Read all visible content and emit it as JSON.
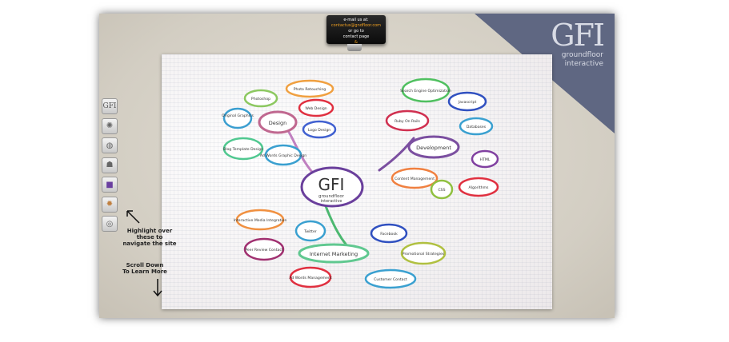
{
  "contact": {
    "line1": "e-mail us at:",
    "email": "contactus@gndfloor.com",
    "line3": "or go to",
    "line4": "contact page",
    "amp": "&"
  },
  "brand": {
    "logo": "GFI",
    "line1": "groundfloor",
    "line2": "interactive"
  },
  "nav": {
    "items": [
      {
        "label": "GFI",
        "icon": "gfi-logo-icon"
      },
      {
        "icon": "pinwheel-icon"
      },
      {
        "icon": "disc-icon"
      },
      {
        "icon": "people-icon"
      },
      {
        "icon": "book-icon"
      },
      {
        "icon": "globe-icon"
      },
      {
        "icon": "compass-icon"
      }
    ]
  },
  "hints": {
    "highlight": [
      "Highlight over",
      "these to",
      "navigate the site"
    ],
    "scroll": [
      "Scroll Down",
      "To Learn More"
    ]
  },
  "mindmap": {
    "center": {
      "logo": "GFI",
      "line1": "groundfloor",
      "line2": "interactive"
    },
    "design": {
      "hub": "Design",
      "bubbles": [
        "Photo Retouching",
        "Photoshop",
        "Web Design",
        "Original Graphics",
        "Logo Design",
        "Blog Template Design",
        "Ad Words Graphic Design"
      ]
    },
    "development": {
      "hub": "Development",
      "bubbles": [
        "Search Engine Optimization",
        "Javascript",
        "Ruby On Rails",
        "Databases",
        "HTML",
        "Content Management",
        "CSS",
        "Algorithms"
      ]
    },
    "marketing": {
      "hub": "Internet Marketing",
      "bubbles": [
        "Interactive Media Integration",
        "Twitter",
        "Facebook",
        "Peer Review Contact",
        "Promotional Strategies",
        "Ad Words Management",
        "Customer Contact"
      ]
    }
  },
  "colors": {
    "frame": "#d8d3c8",
    "corner": "#5f6782",
    "paper": "#f7f5f5",
    "contact_bg": "#111111",
    "contact_accent": "#f0a020"
  }
}
